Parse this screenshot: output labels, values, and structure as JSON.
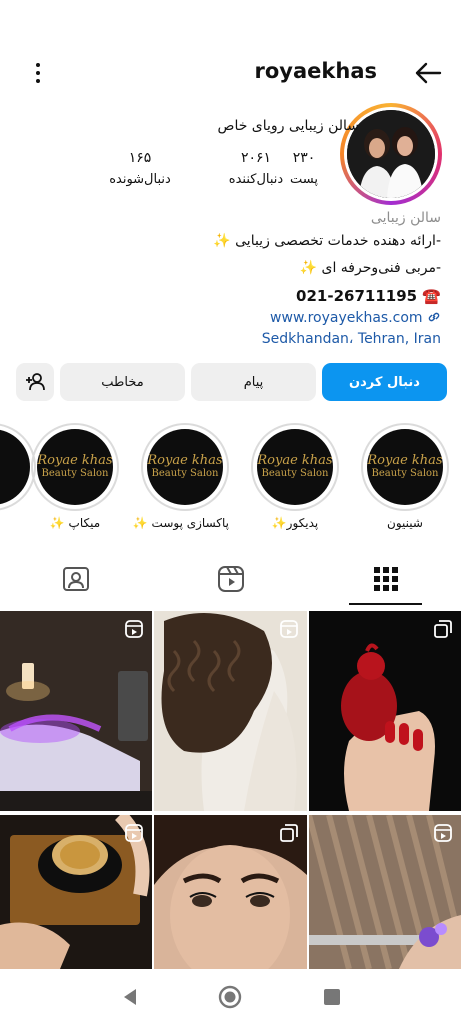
{
  "header": {
    "username": "royaekhas",
    "menu_icon": "more-vertical-icon",
    "back_icon": "back-arrow-icon"
  },
  "profile": {
    "display_name": "سالن زیبایی رویای خاص",
    "stats": {
      "posts": {
        "value": "۲۳۰",
        "label": "پست"
      },
      "following": {
        "value": "۲۰۶۱",
        "label": "دنبال‌کننده"
      },
      "followers": {
        "value": "۱۶۵",
        "label": "دنبال‌شونده"
      }
    },
    "category": "سالن زیبایی",
    "bio_line1": "-ارائه دهنده خدمات تخصصی زیبایی",
    "bio_line2": "-مربی فنی‌وحرفه ای",
    "sparkle": "✨",
    "phone_icon": "☎️",
    "phone": "021-26711195",
    "link": "www.royayekhas.com",
    "location": "Sedkhandan، Tehran, Iran"
  },
  "actions": {
    "follow": "دنبال کردن",
    "message": "پیام",
    "contact": "مخاطب"
  },
  "highlights": [
    {
      "label": "شینیون"
    },
    {
      "label": "پدیکور✨"
    },
    {
      "label": "پاکسازی پوست ✨"
    },
    {
      "label": "میکاپ ✨"
    }
  ],
  "highlight_logo": {
    "title": "Royae khas",
    "subtitle": "Beauty Salon"
  },
  "tabs": [
    "grid-tab",
    "reels-tab",
    "tagged-tab"
  ],
  "colors": {
    "accent": "#0c95f0",
    "link": "#1e5aa8",
    "logo_gold": "#c9a24a"
  }
}
